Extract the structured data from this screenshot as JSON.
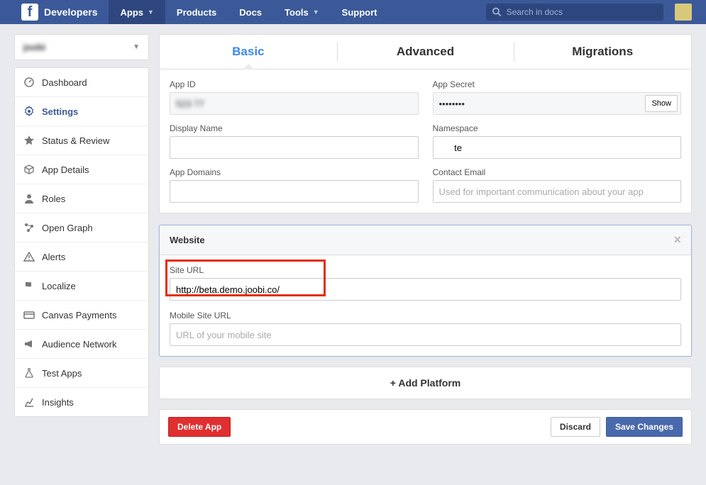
{
  "topnav": {
    "brand": "Developers",
    "items": [
      "Apps",
      "Products",
      "Docs",
      "Tools",
      "Support"
    ],
    "active_index": 0,
    "dropdown_indices": [
      0,
      3
    ],
    "search_placeholder": "Search in docs"
  },
  "sidebar": {
    "app_name": "joobi",
    "items": [
      {
        "icon": "gauge",
        "label": "Dashboard"
      },
      {
        "icon": "gear",
        "label": "Settings"
      },
      {
        "icon": "star",
        "label": "Status & Review"
      },
      {
        "icon": "cube",
        "label": "App Details"
      },
      {
        "icon": "person",
        "label": "Roles"
      },
      {
        "icon": "graph",
        "label": "Open Graph"
      },
      {
        "icon": "alert",
        "label": "Alerts"
      },
      {
        "icon": "flag",
        "label": "Localize"
      },
      {
        "icon": "card",
        "label": "Canvas Payments"
      },
      {
        "icon": "megaphone",
        "label": "Audience Network"
      },
      {
        "icon": "flask",
        "label": "Test Apps"
      },
      {
        "icon": "chart",
        "label": "Insights"
      }
    ],
    "active_index": 1
  },
  "tabs": {
    "items": [
      "Basic",
      "Advanced",
      "Migrations"
    ],
    "active_index": 0
  },
  "basic": {
    "app_id_label": "App ID",
    "app_id_value": "523            77",
    "app_secret_label": "App Secret",
    "app_secret_value": "••••••••",
    "show_button": "Show",
    "display_name_label": "Display Name",
    "display_name_value": "      ",
    "namespace_label": "Namespace",
    "namespace_value": "      te",
    "app_domains_label": "App Domains",
    "app_domains_value": "",
    "contact_email_label": "Contact Email",
    "contact_email_placeholder": "Used for important communication about your app"
  },
  "website": {
    "title": "Website",
    "site_url_label": "Site URL",
    "site_url_value": "http://beta.demo.joobi.co/",
    "mobile_url_label": "Mobile Site URL",
    "mobile_url_placeholder": "URL of your mobile site"
  },
  "add_platform": "Add Platform",
  "footer": {
    "delete": "Delete App",
    "discard": "Discard",
    "save": "Save Changes"
  }
}
